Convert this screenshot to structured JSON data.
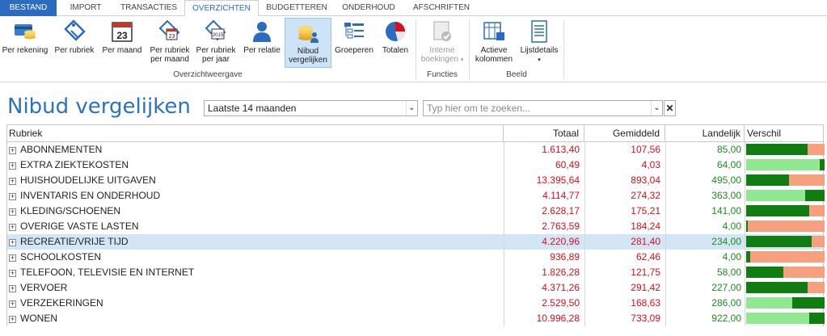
{
  "tabs": [
    {
      "label": "BESTAND"
    },
    {
      "label": "IMPORT"
    },
    {
      "label": "TRANSACTIES"
    },
    {
      "label": "OVERZICHTEN"
    },
    {
      "label": "BUDGETTEREN"
    },
    {
      "label": "ONDERHOUD"
    },
    {
      "label": "AFSCHRIFTEN"
    }
  ],
  "ribbon": {
    "buttons": [
      {
        "label": "Per rekening",
        "icon": "accounts-icon"
      },
      {
        "label": "Per rubriek",
        "icon": "tag-icon"
      },
      {
        "label": "Per maand",
        "icon": "calendar-icon"
      },
      {
        "label": "Per rubriek per maand",
        "icon": "tag-calendar-icon"
      },
      {
        "label": "Per rubriek per jaar",
        "icon": "tag-year-icon"
      },
      {
        "label": "Per relatie",
        "icon": "person-icon"
      },
      {
        "label": "Nibud vergelijken",
        "icon": "coins-person-icon"
      },
      {
        "label": "Groeperen",
        "icon": "group-list-icon"
      },
      {
        "label": "Totalen",
        "icon": "pie-chart-icon"
      },
      {
        "label": "Interne boekingen",
        "icon": "transfer-icon"
      },
      {
        "label": "Actieve kolommen",
        "icon": "columns-icon"
      },
      {
        "label": "Lijstdetails",
        "icon": "list-details-icon"
      }
    ],
    "groups": {
      "overview": "Overzichtweergave",
      "functions": "Functies",
      "view": "Beeld"
    }
  },
  "page": {
    "title": "Nibud vergelijken",
    "period": "Laatste 14 maanden",
    "search_placeholder": "Typ hier om te zoeken..."
  },
  "table": {
    "columns": [
      "Rubriek",
      "Totaal",
      "Gemiddeld",
      "Landelijk",
      "Verschil"
    ],
    "rows": [
      {
        "name": "ABONNEMENTEN",
        "totaal": "1.613,40",
        "gemiddeld": "107,56",
        "landelijk": "85,00",
        "verschil": {
          "dark": 0.78,
          "pattern": "dark-salmon"
        }
      },
      {
        "name": "EXTRA ZIEKTEKOSTEN",
        "totaal": "60,49",
        "gemiddeld": "4,03",
        "landelijk": "64,00",
        "verschil": {
          "dark": 0.06,
          "pattern": "light-dark"
        }
      },
      {
        "name": "HUISHOUDELIJKE UITGAVEN",
        "totaal": "13.395,64",
        "gemiddeld": "893,04",
        "landelijk": "495,00",
        "verschil": {
          "dark": 0.55,
          "pattern": "dark-salmon"
        }
      },
      {
        "name": "INVENTARIS EN ONDERHOUD",
        "totaal": "4.114,77",
        "gemiddeld": "274,32",
        "landelijk": "363,00",
        "verschil": {
          "dark": 0.25,
          "pattern": "light-dark"
        }
      },
      {
        "name": "KLEDING/SCHOENEN",
        "totaal": "2.628,17",
        "gemiddeld": "175,21",
        "landelijk": "141,00",
        "verschil": {
          "dark": 0.8,
          "pattern": "dark-salmon"
        }
      },
      {
        "name": "OVERIGE VASTE LASTEN",
        "totaal": "2.763,59",
        "gemiddeld": "184,24",
        "landelijk": "4,00",
        "verschil": {
          "dark": 0.02,
          "pattern": "dark-salmon"
        }
      },
      {
        "name": "RECREATIE/VRIJE TIJD",
        "totaal": "4.220,96",
        "gemiddeld": "281,40",
        "landelijk": "234,00",
        "verschil": {
          "dark": 0.83,
          "pattern": "dark-salmon"
        }
      },
      {
        "name": "SCHOOLKOSTEN",
        "totaal": "936,89",
        "gemiddeld": "62,46",
        "landelijk": "4,00",
        "verschil": {
          "dark": 0.05,
          "pattern": "dark-salmon"
        }
      },
      {
        "name": "TELEFOON, TELEVISIE EN INTERNET",
        "totaal": "1.826,28",
        "gemiddeld": "121,75",
        "landelijk": "58,00",
        "verschil": {
          "dark": 0.47,
          "pattern": "dark-salmon"
        }
      },
      {
        "name": "VERVOER",
        "totaal": "4.371,26",
        "gemiddeld": "291,42",
        "landelijk": "227,00",
        "verschil": {
          "dark": 0.78,
          "pattern": "dark-salmon"
        }
      },
      {
        "name": "VERZEKERINGEN",
        "totaal": "2.529,50",
        "gemiddeld": "168,63",
        "landelijk": "286,00",
        "verschil": {
          "dark": 0.41,
          "pattern": "light-dark"
        }
      },
      {
        "name": "WONEN",
        "totaal": "10.996,28",
        "gemiddeld": "733,09",
        "landelijk": "922,00",
        "verschil": {
          "dark": 0.2,
          "pattern": "light-dark"
        }
      }
    ],
    "selected_row": 6
  },
  "colors": {
    "accent": "#2b6cc0",
    "title": "#2b72c2",
    "over_budget_text": "#d6101c",
    "national_text": "#1f8a1f",
    "bar_dark_green": "#0f7d0f",
    "bar_light_green": "#90e890",
    "bar_salmon": "#f7a07f",
    "selected_row": "#d3e6f5"
  }
}
